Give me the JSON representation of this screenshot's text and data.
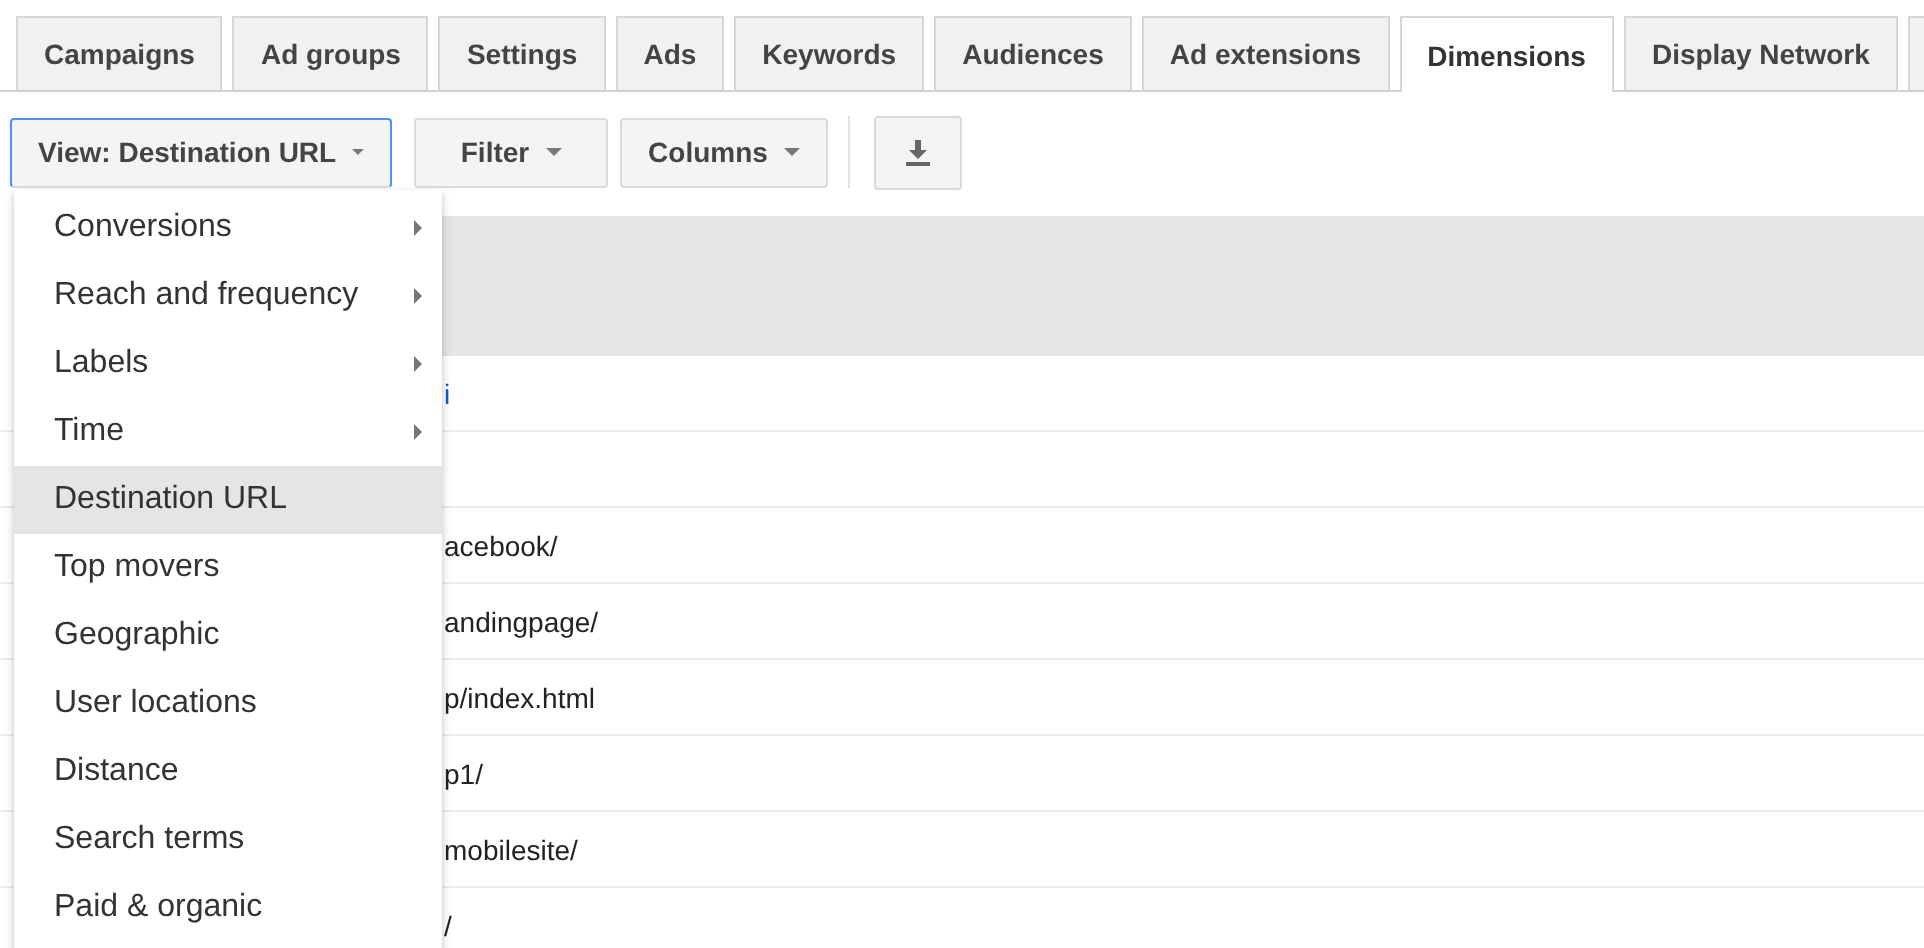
{
  "tabs": [
    {
      "label": "Campaigns",
      "selected": false
    },
    {
      "label": "Ad groups",
      "selected": false
    },
    {
      "label": "Settings",
      "selected": false
    },
    {
      "label": "Ads",
      "selected": false
    },
    {
      "label": "Keywords",
      "selected": false
    },
    {
      "label": "Audiences",
      "selected": false
    },
    {
      "label": "Ad extensions",
      "selected": false
    },
    {
      "label": "Dimensions",
      "selected": true
    },
    {
      "label": "Display Network",
      "selected": false
    }
  ],
  "toolbar": {
    "view_button": "View: Destination URL",
    "filter_button": "Filter",
    "columns_button": "Columns"
  },
  "view_menu": [
    {
      "label": "Conversions",
      "submenu": true,
      "selected": false
    },
    {
      "label": "Reach and frequency",
      "submenu": true,
      "selected": false
    },
    {
      "label": "Labels",
      "submenu": true,
      "selected": false
    },
    {
      "label": "Time",
      "submenu": true,
      "selected": false
    },
    {
      "label": "Destination URL",
      "submenu": false,
      "selected": true
    },
    {
      "label": "Top movers",
      "submenu": false,
      "selected": false
    },
    {
      "label": "Geographic",
      "submenu": false,
      "selected": false
    },
    {
      "label": "User locations",
      "submenu": false,
      "selected": false
    },
    {
      "label": "Distance",
      "submenu": false,
      "selected": false
    },
    {
      "label": "Search terms",
      "submenu": false,
      "selected": false
    },
    {
      "label": "Paid & organic",
      "submenu": false,
      "selected": false
    }
  ],
  "table_rows": [
    {
      "kind": "link",
      "text": "i"
    },
    {
      "kind": "empty"
    },
    {
      "kind": "text",
      "text": "acebook/"
    },
    {
      "kind": "text",
      "text": "andingpage/"
    },
    {
      "kind": "text",
      "text": "p/index.html"
    },
    {
      "kind": "text",
      "text": "p1/"
    },
    {
      "kind": "text",
      "text": "mobilesite/"
    },
    {
      "kind": "text",
      "text": "/"
    }
  ]
}
